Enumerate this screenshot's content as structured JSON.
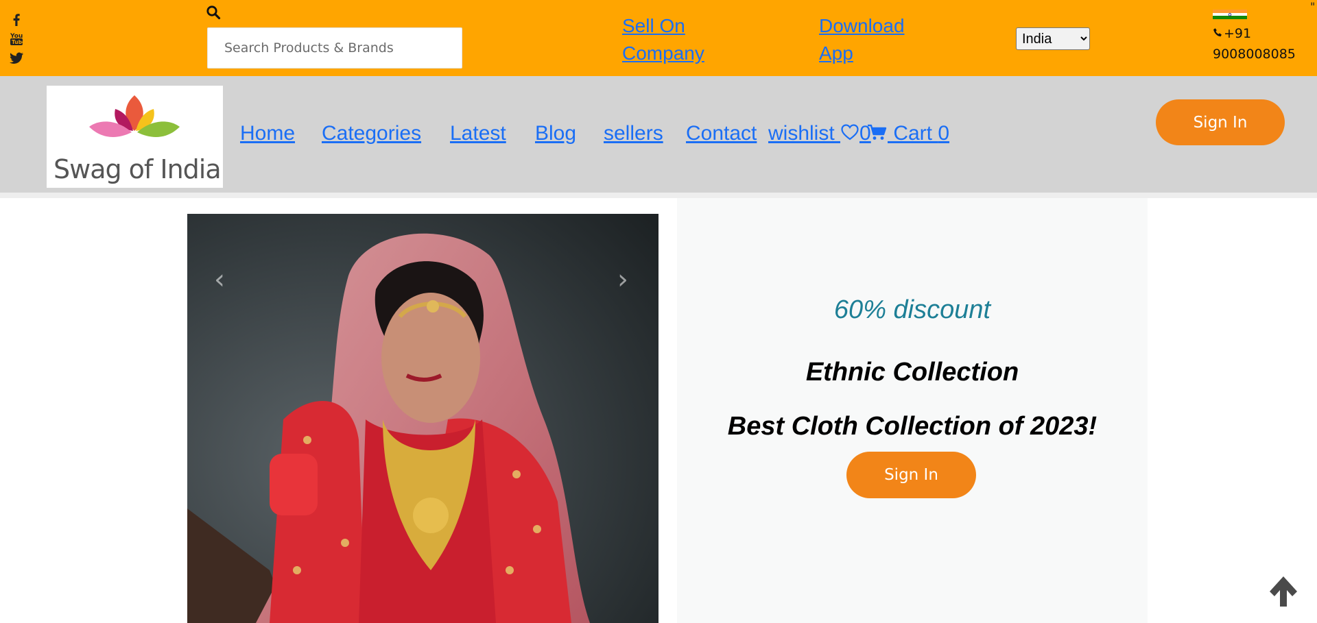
{
  "topbar": {
    "social_icons": [
      "facebook-icon",
      "youtube-icon",
      "twitter-icon"
    ],
    "search_placeholder": "Search Products & Brands",
    "sell_on_company": "Sell On Company",
    "download_app": "Download App",
    "country_selected": "India",
    "phone": "+91 9008008085",
    "corner_mark": "\""
  },
  "brand": {
    "logo_text": "Swag of India"
  },
  "nav": {
    "home": "Home",
    "categories": "Categories",
    "latest": "Latest",
    "blog": "Blog",
    "sellers": "sellers",
    "contact": "Contact",
    "wishlist_label": "wishlist ",
    "wishlist_count": "0",
    "cart_label": " Cart ",
    "cart_count": "0",
    "sign_in": "Sign In"
  },
  "hero": {
    "prev_glyph": "‹",
    "next_glyph": "›",
    "discount": "60% discount",
    "headline": "Ethnic Collection",
    "subheadline": "Best Cloth Collection of 2023!",
    "sign_in": "Sign In"
  },
  "colors": {
    "topbar": "#ffa500",
    "navbar": "#d3d3d3",
    "accent_button": "#f28518",
    "link": "#1a6ef5",
    "discount_text": "#1d7f96"
  }
}
